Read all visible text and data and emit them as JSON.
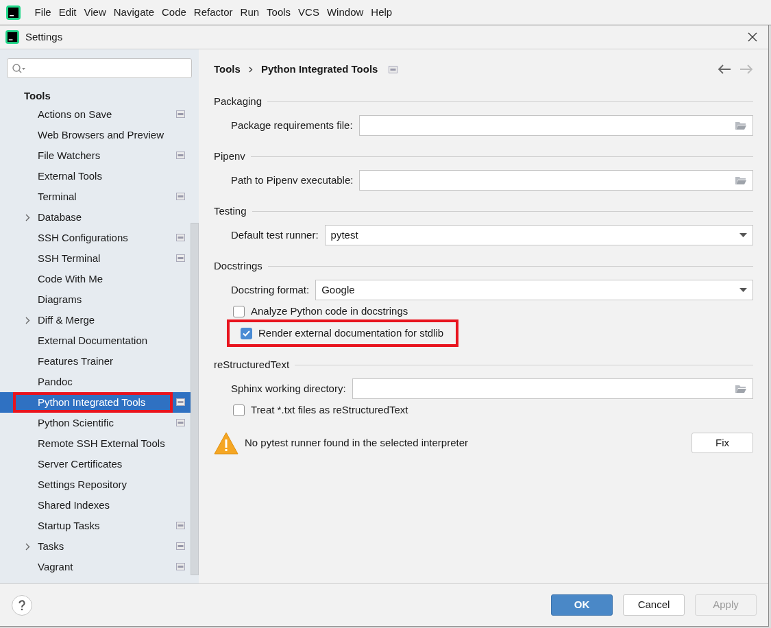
{
  "menu_bar": [
    {
      "label": "File"
    },
    {
      "label": "Edit"
    },
    {
      "label": "View"
    },
    {
      "label": "Navigate"
    },
    {
      "label": "Code"
    },
    {
      "label": "Refactor"
    },
    {
      "label": "Run"
    },
    {
      "label": "Tools"
    },
    {
      "label": "VCS"
    },
    {
      "label": "Window"
    },
    {
      "label": "Help"
    }
  ],
  "window": {
    "title": "Settings"
  },
  "sidebar": {
    "group": "Tools",
    "items": [
      {
        "label": "Actions on Save",
        "selected": false,
        "expandable": false,
        "project_level": true,
        "annotated": false
      },
      {
        "label": "Web Browsers and Preview",
        "selected": false,
        "expandable": false,
        "project_level": false,
        "annotated": false
      },
      {
        "label": "File Watchers",
        "selected": false,
        "expandable": false,
        "project_level": true,
        "annotated": false
      },
      {
        "label": "External Tools",
        "selected": false,
        "expandable": false,
        "project_level": false,
        "annotated": false
      },
      {
        "label": "Terminal",
        "selected": false,
        "expandable": false,
        "project_level": true,
        "annotated": false
      },
      {
        "label": "Database",
        "selected": false,
        "expandable": true,
        "project_level": false,
        "annotated": false
      },
      {
        "label": "SSH Configurations",
        "selected": false,
        "expandable": false,
        "project_level": true,
        "annotated": false
      },
      {
        "label": "SSH Terminal",
        "selected": false,
        "expandable": false,
        "project_level": true,
        "annotated": false
      },
      {
        "label": "Code With Me",
        "selected": false,
        "expandable": false,
        "project_level": false,
        "annotated": false
      },
      {
        "label": "Diagrams",
        "selected": false,
        "expandable": false,
        "project_level": false,
        "annotated": false
      },
      {
        "label": "Diff & Merge",
        "selected": false,
        "expandable": true,
        "project_level": false,
        "annotated": false
      },
      {
        "label": "External Documentation",
        "selected": false,
        "expandable": false,
        "project_level": false,
        "annotated": false
      },
      {
        "label": "Features Trainer",
        "selected": false,
        "expandable": false,
        "project_level": false,
        "annotated": false
      },
      {
        "label": "Pandoc",
        "selected": false,
        "expandable": false,
        "project_level": false,
        "annotated": false
      },
      {
        "label": "Python Integrated Tools",
        "selected": true,
        "expandable": false,
        "project_level": true,
        "annotated": true
      },
      {
        "label": "Python Scientific",
        "selected": false,
        "expandable": false,
        "project_level": true,
        "annotated": false
      },
      {
        "label": "Remote SSH External Tools",
        "selected": false,
        "expandable": false,
        "project_level": false,
        "annotated": false
      },
      {
        "label": "Server Certificates",
        "selected": false,
        "expandable": false,
        "project_level": false,
        "annotated": false
      },
      {
        "label": "Settings Repository",
        "selected": false,
        "expandable": false,
        "project_level": false,
        "annotated": false
      },
      {
        "label": "Shared Indexes",
        "selected": false,
        "expandable": false,
        "project_level": false,
        "annotated": false
      },
      {
        "label": "Startup Tasks",
        "selected": false,
        "expandable": false,
        "project_level": true,
        "annotated": false
      },
      {
        "label": "Tasks",
        "selected": false,
        "expandable": true,
        "project_level": true,
        "annotated": false
      },
      {
        "label": "Vagrant",
        "selected": false,
        "expandable": false,
        "project_level": true,
        "annotated": false
      }
    ]
  },
  "breadcrumb": [
    "Tools",
    "Python Integrated Tools"
  ],
  "sections": [
    {
      "title": "Packaging",
      "rows": [
        {
          "kind": "path",
          "label": "Package requirements file:"
        }
      ]
    },
    {
      "title": "Pipenv",
      "rows": [
        {
          "kind": "path",
          "label": "Path to Pipenv executable:"
        }
      ]
    },
    {
      "title": "Testing",
      "rows": [
        {
          "kind": "select",
          "label": "Default test runner:",
          "value": "pytest"
        }
      ]
    },
    {
      "title": "Docstrings",
      "rows": [
        {
          "kind": "select",
          "label": "Docstring format:",
          "value": "Google"
        },
        {
          "kind": "checkbox",
          "label": "Analyze Python code in docstrings",
          "checked": false,
          "annotated": false
        },
        {
          "kind": "checkbox",
          "label": "Render external documentation for stdlib",
          "checked": true,
          "annotated": true
        }
      ]
    },
    {
      "title": "reStructuredText",
      "rows": [
        {
          "kind": "path",
          "label": "Sphinx working directory:"
        },
        {
          "kind": "checkbox",
          "label": "Treat *.txt files as reStructuredText",
          "checked": false,
          "annotated": false
        }
      ]
    }
  ],
  "warning": {
    "message": "No pytest runner found in the selected interpreter",
    "action": "Fix"
  },
  "buttons": [
    {
      "label": "OK",
      "kind": "primary",
      "disabled": false
    },
    {
      "label": "Cancel",
      "kind": "normal",
      "disabled": false
    },
    {
      "label": "Apply",
      "kind": "normal",
      "disabled": true
    }
  ]
}
